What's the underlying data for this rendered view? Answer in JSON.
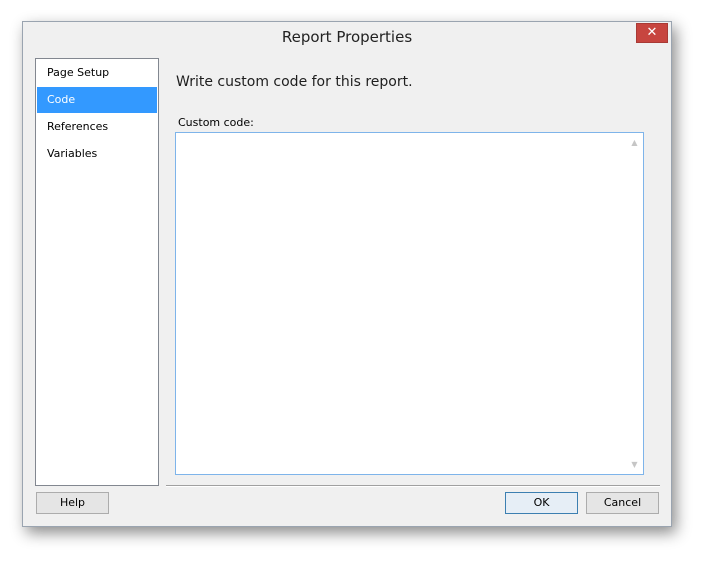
{
  "window": {
    "title": "Report Properties",
    "close_label": "✕"
  },
  "nav": {
    "items": [
      {
        "label": "Page Setup",
        "selected": false
      },
      {
        "label": "Code",
        "selected": true
      },
      {
        "label": "References",
        "selected": false
      },
      {
        "label": "Variables",
        "selected": false
      }
    ]
  },
  "main": {
    "heading": "Write custom code for this report.",
    "code_label": "Custom code:",
    "code_value": ""
  },
  "footer": {
    "help_label": "Help",
    "ok_label": "OK",
    "cancel_label": "Cancel"
  },
  "colors": {
    "selection": "#3399ff",
    "close_button": "#c7453f",
    "focus_border": "#7eb4ea"
  }
}
